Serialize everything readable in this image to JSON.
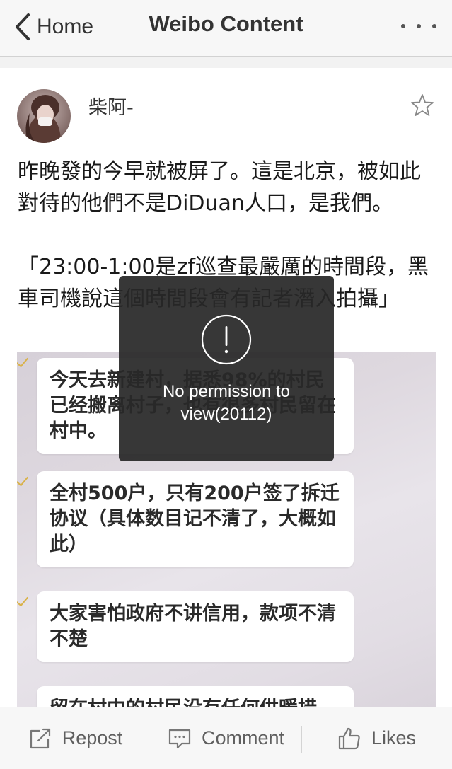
{
  "navbar": {
    "back_label": "Home",
    "title": "Weibo Content",
    "more_icon": "more-dots-icon"
  },
  "post": {
    "author": "柴阿-",
    "avatar_icon": "avatar",
    "favorite_icon": "star-outline-icon",
    "text": "昨晚發的今早就被屏了。這是北京，被如此對待的他們不是DiDuan人口，是我們。\n\n「23:00-1:00是zf巡查最嚴厲的時間段，黑車司機說這個時間段會有記者潛入拍攝」"
  },
  "image": {
    "messages": [
      "今天去新建村，据悉98%的村民已经搬离村子，也有很多村民留在村中。",
      "全村500户，只有200户签了拆迁协议（具体数目记不清了，大概如此）",
      "大家害怕政府不讲信用，款项不清不楚",
      "留在村中的村民没有任何供暖措"
    ]
  },
  "toast": {
    "icon": "exclamation-circle-icon",
    "message": "No permission to view(20112)"
  },
  "toolbar": {
    "repost_label": "Repost",
    "comment_label": "Comment",
    "likes_label": "Likes"
  },
  "colors": {
    "nav_bg": "#f7f7f7",
    "toast_bg": "#282828",
    "tick": "#d9b24a"
  }
}
